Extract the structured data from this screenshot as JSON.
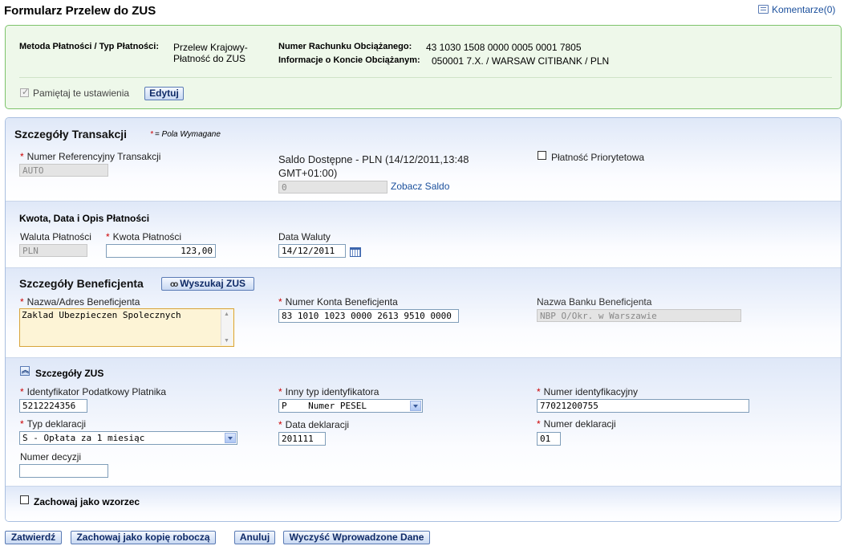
{
  "page": {
    "title": "Formularz Przelew do ZUS",
    "comments_link": "Komentarze(0)"
  },
  "summary": {
    "method_label": "Metoda Płatności / Typ Płatności:",
    "method_value_line1": "Przelew Krajowy-",
    "method_value_line2": "Płatność do ZUS",
    "account_label": "Numer Rachunku Obciążanego:",
    "account_value": "43 1030 1508 0000 0005 0001 7805",
    "info_label": "Informacje o Koncie Obciążanym:",
    "info_value": "050001 7.X. / WARSAW CITIBANK / PLN",
    "remember_label": "Pamiętaj te ustawienia",
    "remember_checked": true,
    "edit_button": "Edytuj"
  },
  "transaction": {
    "heading": "Szczegóły Transakcji",
    "required_note": "= Pola Wymagane",
    "ref_label": "Numer Referencyjny Transakcji",
    "ref_value": "AUTO",
    "balance_label_line1": "Saldo Dostępne - PLN (14/12/2011,13:48",
    "balance_label_line2": "GMT+01:00)",
    "balance_value": "0",
    "balance_link": "Zobacz Saldo",
    "priority_label": "Płatność Priorytetowa"
  },
  "amount": {
    "heading": "Kwota, Data i Opis Płatności",
    "currency_label": "Waluta Płatności",
    "currency_value": "PLN",
    "amount_label": "Kwota Płatności",
    "amount_value": "123,00",
    "date_label": "Data Waluty",
    "date_value": "14/12/2011"
  },
  "beneficiary": {
    "heading": "Szczegóły Beneficjenta",
    "search_button": "Wyszukaj ZUS",
    "name_label": "Nazwa/Adres Beneficjenta",
    "name_value": "Zaklad Ubezpieczen Spolecznych",
    "account_label": "Numer Konta Beneficjenta",
    "account_value": "83 1010 1023 0000 2613 9510 0000",
    "bank_label": "Nazwa Banku Beneficjenta",
    "bank_value": "NBP O/Okr. w Warszawie"
  },
  "zus": {
    "heading": "Szczegóły ZUS",
    "tax_id_label": "Identyfikator Podatkowy Platnika",
    "tax_id_value": "5212224356",
    "other_id_type_label": "Inny typ identyfikatora",
    "other_id_type_value": "P    Numer PESEL",
    "id_number_label": "Numer identyfikacyjny",
    "id_number_value": "77021200755",
    "decl_type_label": "Typ deklaracji",
    "decl_type_value": "S - Opłata za 1 miesiąc",
    "decl_date_label": "Data deklaracji",
    "decl_date_value": "201111",
    "decl_number_label": "Numer deklaracji",
    "decl_number_value": "01",
    "decision_label": "Numer decyzji",
    "decision_value": ""
  },
  "template": {
    "save_as_template_label": "Zachowaj jako wzorzec"
  },
  "footer": {
    "confirm": "Zatwierdź",
    "save_draft": "Zachowaj jako kopię roboczą",
    "cancel": "Anuluj",
    "clear": "Wyczyść Wprowadzone Dane"
  },
  "colors": {
    "summary_bg": "#eef8ea",
    "summary_border": "#7dc36b",
    "link": "#1a4f9c",
    "required": "#cc0000"
  }
}
